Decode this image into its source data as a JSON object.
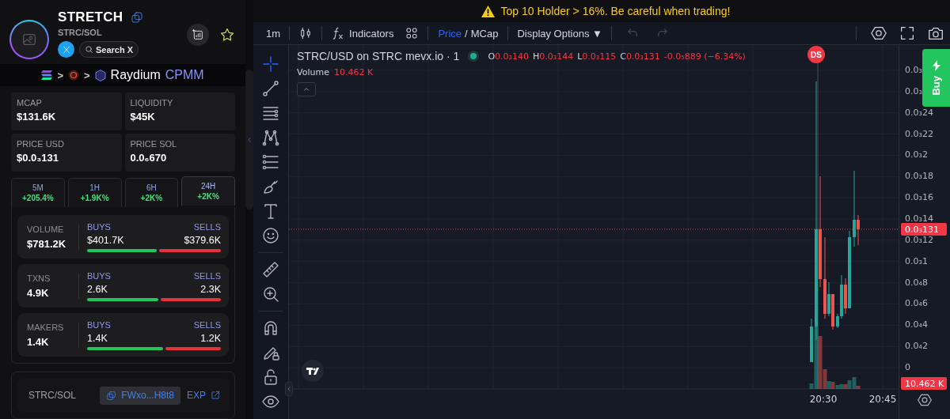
{
  "token": {
    "name": "STRETCH",
    "pair": "STRC/SOL",
    "search_label": "Search X"
  },
  "route": {
    "separators": [
      ">",
      ">"
    ],
    "dex": "Raydium",
    "pool_type": "CPMM"
  },
  "stats": [
    {
      "label": "MCAP",
      "value": "$131.6K"
    },
    {
      "label": "LIQUIDITY",
      "value": "$45K"
    },
    {
      "label": "PRICE USD",
      "value": "$0.0₃131"
    },
    {
      "label": "PRICE SOL",
      "value": "0.0₆670"
    }
  ],
  "timeframes": [
    {
      "label": "5M",
      "change": "+205.4%",
      "selected": false
    },
    {
      "label": "1H",
      "change": "+1.9K%",
      "selected": false
    },
    {
      "label": "6H",
      "change": "+2K%",
      "selected": false
    },
    {
      "label": "24H",
      "change": "+2K%",
      "selected": true
    }
  ],
  "activity": [
    {
      "label": "VOLUME",
      "total": "$781.2K",
      "buys_label": "BUYS",
      "buys": "$401.7K",
      "sells_label": "SELLS",
      "sells": "$379.6K",
      "level": 0.52
    },
    {
      "label": "TXNS",
      "total": "4.9K",
      "buys_label": "BUYS",
      "buys": "2.6K",
      "sells_label": "SELLS",
      "sells": "2.3K",
      "level": 0.53
    },
    {
      "label": "MAKERS",
      "total": "1.4K",
      "buys_label": "BUYS",
      "buys": "1.4K",
      "sells_label": "SELLS",
      "sells": "1.2K",
      "level": 0.57
    }
  ],
  "pair_info": {
    "label": "STRC/SOL",
    "address": "FWxo...H8t8",
    "explorer": "EXP"
  },
  "banner": {
    "text": "Top 10 Holder > 16%. Be careful when trading!"
  },
  "toolbar": {
    "interval": "1m",
    "indicators": "Indicators",
    "price_modes": [
      {
        "label": "Price",
        "selected": true
      },
      {
        "label": "MCap",
        "selected": false
      }
    ],
    "mode_separator": "/",
    "display_options": "Display Options ▼"
  },
  "tools": [
    {
      "kind": "crosshair",
      "selected": true
    },
    {
      "kind": "trend_line",
      "selected": false
    },
    {
      "kind": "horizontal_lines",
      "selected": false
    },
    {
      "kind": "pattern",
      "selected": false
    },
    {
      "kind": "fib",
      "selected": false
    },
    {
      "kind": "brush",
      "selected": false
    },
    {
      "kind": "text",
      "selected": false
    },
    {
      "kind": "emoji",
      "selected": false
    },
    {
      "kind": "ruler",
      "selected": false
    },
    {
      "kind": "zoom",
      "selected": false
    },
    {
      "kind": "magnet",
      "selected": false
    },
    {
      "kind": "pencil_lock",
      "selected": false
    },
    {
      "kind": "lock",
      "selected": false
    },
    {
      "kind": "eye",
      "selected": false
    }
  ],
  "legend": {
    "symbol": "STRC/USD on STRC mevx.io · 1",
    "ohlc": [
      {
        "key": "O",
        "value": "0.0₃140"
      },
      {
        "key": "H",
        "value": "0.0₃144"
      },
      {
        "key": "L",
        "value": "0.0₃115"
      },
      {
        "key": "C",
        "value": "0.0₃131"
      }
    ],
    "change": "-0.0₅889 (−6.34%)",
    "volume_label": "Volume",
    "volume_value": "10.462 K"
  },
  "marker": {
    "label": "DS"
  },
  "price_axis": {
    "labels": [
      "0.0₃",
      "0.0₃",
      "0.0₃24",
      "0.0₃22",
      "0.0₃2",
      "0.0₃18",
      "0.0₃16",
      "0.0₃14",
      "0.0₃12",
      "0.0₃1",
      "0.0₄8",
      "0.0₄6",
      "0.0₄4",
      "0.0₄2",
      "0"
    ],
    "last_price": "0.0₃131",
    "last_volume": "10.462 K"
  },
  "time_axis": [
    "20:30",
    "20:45"
  ],
  "buy_button": {
    "label": "Buy"
  }
}
